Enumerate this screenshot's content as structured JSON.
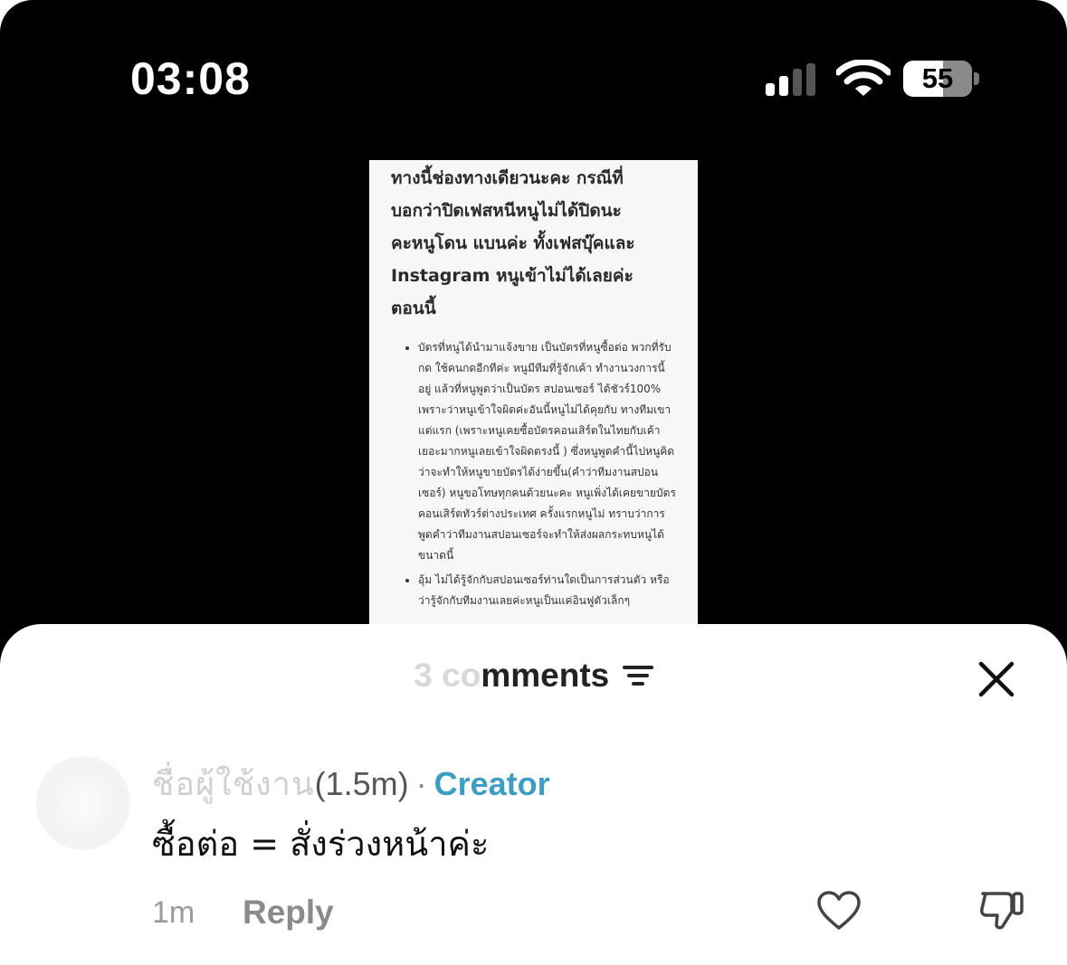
{
  "status_bar": {
    "time": "03:08",
    "battery": "55",
    "signal_icon": "cellular-signal-icon",
    "wifi_icon": "wifi-icon"
  },
  "document": {
    "heading_lines": [
      "ทางนี้ช่องทางเดียวนะคะ กรณีที่",
      "บอกว่าปิดเฟสหนีหนูไม่ได้ปิดนะ",
      "คะหนูโดน แบนค่ะ ทั้งเฟสบุ๊คและ",
      "Instagram หนูเข้าไม่ได้เลยค่ะ",
      "ตอนนี้"
    ],
    "bullets": [
      "บัตรที่หนูได้นำมาแจ้งขาย เป็นบัตรที่หนูซื้อต่อ พวกที่รับกด ใช้คนกดอีกทีค่ะ หนูมีทีมที่รู้จักเค้า ทำงานวงการนี้อยู่ แล้วที่หนูพูดว่าเป็นบัตร สปอนเซอร์ ได้ชัวร์100% เพราะว่าหนูเข้าใจผิดค่ะอันนี้หนูไม่ได้คุยกับ ทางทีมเขาแต่แรก (เพราะหนูเคยซื้อบัตรคอนเสิร์ตในไทยกับเค้าเยอะมากหนูเลยเข้าใจผิดตรงนี้ ) ซึ่งหนูพูดคำนี้ไปหนูคิดว่าจะทำให้หนูขายบัตรได้ง่ายขึ้น(คำว่าทีมงานสปอนเซอร์) หนูขอโทษทุกคนด้วยนะคะ หนูเพิ่งได้เคยขายบัตร คอนเสิร์ตทัวร์ต่างประเทศ ครั้งแรกหนูไม่ ทราบว่าการพูดคำว่าทีมงานสปอนเซอร์จะทำให้ส่งผลกระทบหนูได้ขนาดนี้",
      "อุ้ม ไม่ได้รู้จักกับสปอนเซอร์ท่านใดเป็นการส่วนตัว หรือว่ารู้จักกับทีมงานเลยค่ะหนูเป็นแค่อินฟูตัวเล็กๆ"
    ]
  },
  "comments_sheet": {
    "count_prefix": "3 co",
    "count_suffix": "mments",
    "sort_icon": "sort-filter-icon",
    "close_icon": "close-icon",
    "comment": {
      "author_blurred": "ชื่อผู้ใช้งาน",
      "author_visible": "(1.5m)",
      "separator": "·",
      "creator_badge": "Creator",
      "text": "ซื้อต่อ = สั่งร่วงหน้าค่ะ",
      "time_ago": "1m",
      "reply_label": "Reply",
      "like_icon": "heart-icon",
      "dislike_icon": "thumbs-down-icon"
    }
  }
}
